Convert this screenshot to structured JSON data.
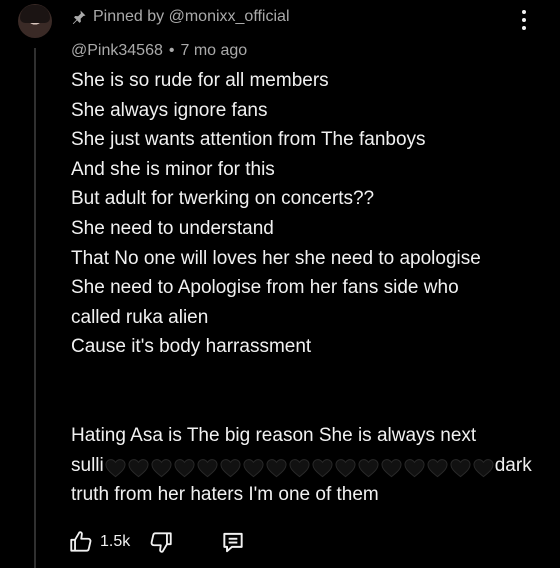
{
  "header": {
    "pinned_label": "Pinned by @monixx_official",
    "author": "@Pink34568",
    "separator": "•",
    "timestamp": "7 mo ago"
  },
  "comment": {
    "lines": [
      "She is so rude for all members",
      "She always ignore fans",
      "She just wants attention from The fanboys",
      "And she is minor for this",
      "But adult for twerking on concerts??",
      "She need to understand",
      "That No one will loves her  she need to apologise",
      "She need to Apologise from her fans side who",
      "called ruka alien",
      "Cause it's body harrassment"
    ],
    "para2_line1": "Hating Asa is The big reason She is always next",
    "para2_line2_start": "sulli",
    "hearts": "🖤🖤🖤🖤🖤🖤🖤🖤🖤🖤🖤🖤🖤🖤🖤🖤🖤",
    "heart_count": 17,
    "para2_line2_end": "dark",
    "para2_line3": "truth from her haters I'm one of them"
  },
  "actions": {
    "like_count": "1.5k",
    "like_icon": "thumbs-up-icon",
    "dislike_icon": "thumbs-down-icon",
    "reply_icon": "reply-icon"
  },
  "icons": {
    "pin": "pin-icon",
    "more": "more-vert-icon"
  },
  "colors": {
    "background": "#000000",
    "text": "#f1f1f1",
    "secondary_text": "#aaaaaa"
  }
}
